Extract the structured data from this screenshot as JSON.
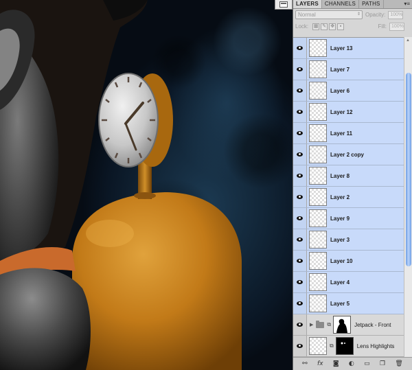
{
  "panel": {
    "tabs": [
      "LAYERS",
      "CHANNELS",
      "PATHS"
    ],
    "active_tab": "LAYERS",
    "blend_mode": "Normal",
    "opacity_label": "Opacity:",
    "opacity_value": "100%",
    "lock_label": "Lock:",
    "fill_label": "Fill:",
    "fill_value": "100%"
  },
  "layers": [
    {
      "name": "Layer 13"
    },
    {
      "name": "Layer 7"
    },
    {
      "name": "Layer 6"
    },
    {
      "name": "Layer 12"
    },
    {
      "name": "Layer 11"
    },
    {
      "name": "Layer 2 copy"
    },
    {
      "name": "Layer 8"
    },
    {
      "name": "Layer 2"
    },
    {
      "name": "Layer 9"
    },
    {
      "name": "Layer 3"
    },
    {
      "name": "Layer 10"
    },
    {
      "name": "Layer 4"
    },
    {
      "name": "Layer 5"
    },
    {
      "name": "Jetpack - Front"
    },
    {
      "name": "Lens Highlights"
    }
  ],
  "colors": {
    "selected_row": "#c8dafa",
    "panel_bg": "#d6d6d6",
    "scroll_thumb": "#6f9ee4",
    "canvas_bg": "#122638"
  },
  "icons": {
    "visibility": "eye-icon",
    "group": "folder-icon",
    "link": "chain-link-icon",
    "bottom": [
      "link-layers-icon",
      "fx-icon",
      "add-mask-icon",
      "adjustment-icon",
      "new-group-icon",
      "new-layer-icon",
      "trash-icon"
    ]
  }
}
